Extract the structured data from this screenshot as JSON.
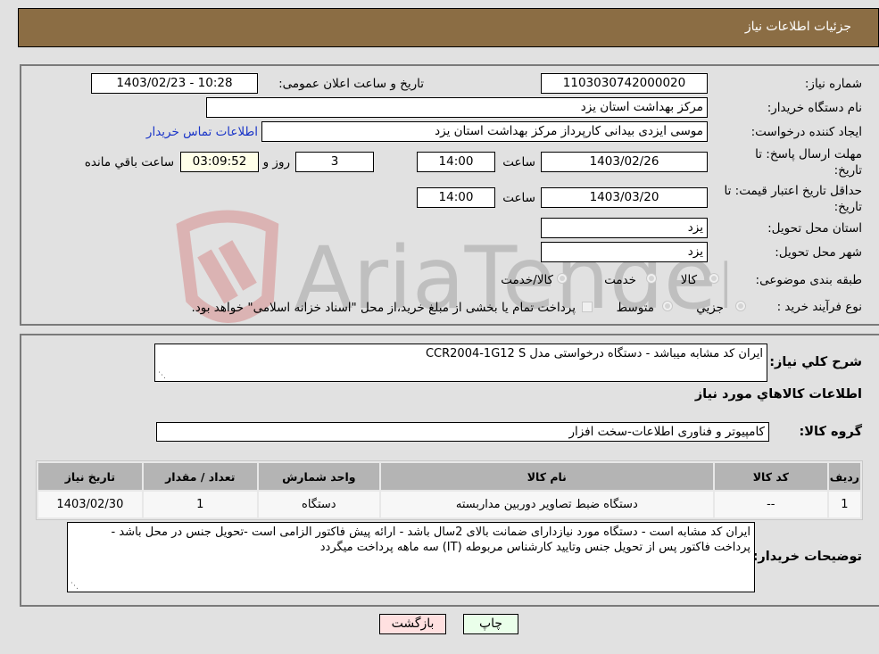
{
  "header": {
    "title": "جزئیات اطلاعات نیاز"
  },
  "details": {
    "need_number_label": "شماره نیاز:",
    "need_number": "1103030742000020",
    "announce_label": "تاریخ و ساعت اعلان عمومی:",
    "announce_value": "1403/02/23 - 10:28",
    "buyer_org_label": "نام دستگاه خریدار:",
    "buyer_org": "مرکز بهداشت استان یزد",
    "requester_label": "ایجاد کننده درخواست:",
    "requester": "موسی ایزدی بیدانی کارپرداز مرکز بهداشت استان یزد",
    "buyer_contact_link": "اطلاعات تماس خریدار",
    "reply_deadline_label": "مهلت ارسال پاسخ: تا تاریخ:",
    "reply_deadline_date": "1403/02/26",
    "time_label": "ساعت",
    "reply_deadline_time": "14:00",
    "days_value": "3",
    "days_label": "روز و",
    "remaining_time": "03:09:52",
    "remaining_label": "ساعت باقي مانده",
    "price_validity_label": "حداقل تاریخ اعتبار قیمت: تا تاریخ:",
    "price_validity_date": "1403/03/20",
    "price_validity_time": "14:00",
    "province_label": "استان محل تحویل:",
    "province": "یزد",
    "city_label": "شهر محل تحویل:",
    "city": "یزد",
    "category_label": "طبقه بندی موضوعی:",
    "category_options": [
      "کالا",
      "خدمت",
      "کالا/خدمت"
    ],
    "purchase_type_label": "نوع فرآیند خرید :",
    "purchase_type_options": [
      "جزيي",
      "متوسط"
    ],
    "payment_note": "پرداخت تمام یا بخشی از مبلغ خرید،از محل \"اسناد خزانه اسلامی\" خواهد بود."
  },
  "summary": {
    "description_label": "شرح کلي نياز:",
    "description": "ایران کد مشابه میباشد - دستگاه درخواستی مدل  CCR2004-1G12 S",
    "goods_info_title": "اطلاعات کالاهاي مورد نياز",
    "goods_group_label": "گروه کالا:",
    "goods_group": "کامپیوتر و فناوری اطلاعات-سخت افزار",
    "table": {
      "columns": [
        "ردیف",
        "کد کالا",
        "نام کالا",
        "واحد شمارش",
        "تعداد / مقدار",
        "تاریخ نیاز"
      ],
      "rows": [
        [
          "1",
          "--",
          "دستگاه ضبط تصاویر دوربین مداربسته",
          "دستگاه",
          "1",
          "1403/02/30"
        ]
      ]
    },
    "buyer_notes_label": "توضیحات خریدار:",
    "buyer_notes": "ایران کد مشابه است - دستگاه مورد نیازدارای ضمانت بالای 2سال باشد - ارائه پیش فاکتور الزامی است -تحویل جنس در محل  باشد - پرداخت فاکتور پس از تحویل جنس وتایید کارشناس مربوطه (IT) سه ماهه پرداخت میگردد"
  },
  "buttons": {
    "print": "چاپ",
    "back": "بازگشت"
  },
  "colors": {
    "header_bg": "#8b6d44",
    "print_bg": "#eaffea",
    "back_bg": "#ffe0e0",
    "remaining_bg": "#ffffe8",
    "link": "#1a35c8"
  },
  "watermark": {
    "text": "AriaTender.neT"
  }
}
